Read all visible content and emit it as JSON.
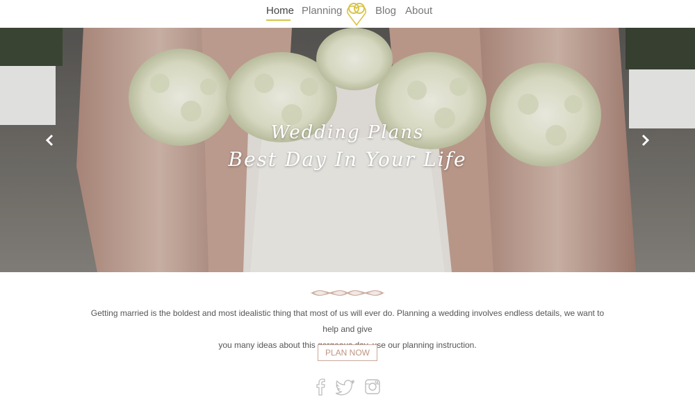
{
  "nav": {
    "links": [
      {
        "label": "Home",
        "active": true
      },
      {
        "label": "Planning",
        "active": false
      },
      {
        "label": "Blog",
        "active": false
      },
      {
        "label": "About",
        "active": false
      }
    ],
    "logo_icon": "interlocked-rings-heart-icon",
    "accent_color": "#d9c44a"
  },
  "hero": {
    "line1": "Wedding Plans",
    "line2": "Best Day In Your Life",
    "prev_icon": "chevron-left-icon",
    "next_icon": "chevron-right-icon"
  },
  "intro": {
    "line1": "Getting married is the boldest and most idealistic thing that most of us will ever do. Planning a wedding involves endless details, we want to help and give",
    "line2": "you many ideas about this gorgeous day. use our planning instruction."
  },
  "cta": {
    "label": "PLAN NOW",
    "color": "#c09583"
  },
  "social": [
    {
      "icon": "facebook-icon"
    },
    {
      "icon": "twitter-icon"
    },
    {
      "icon": "instagram-icon"
    }
  ]
}
